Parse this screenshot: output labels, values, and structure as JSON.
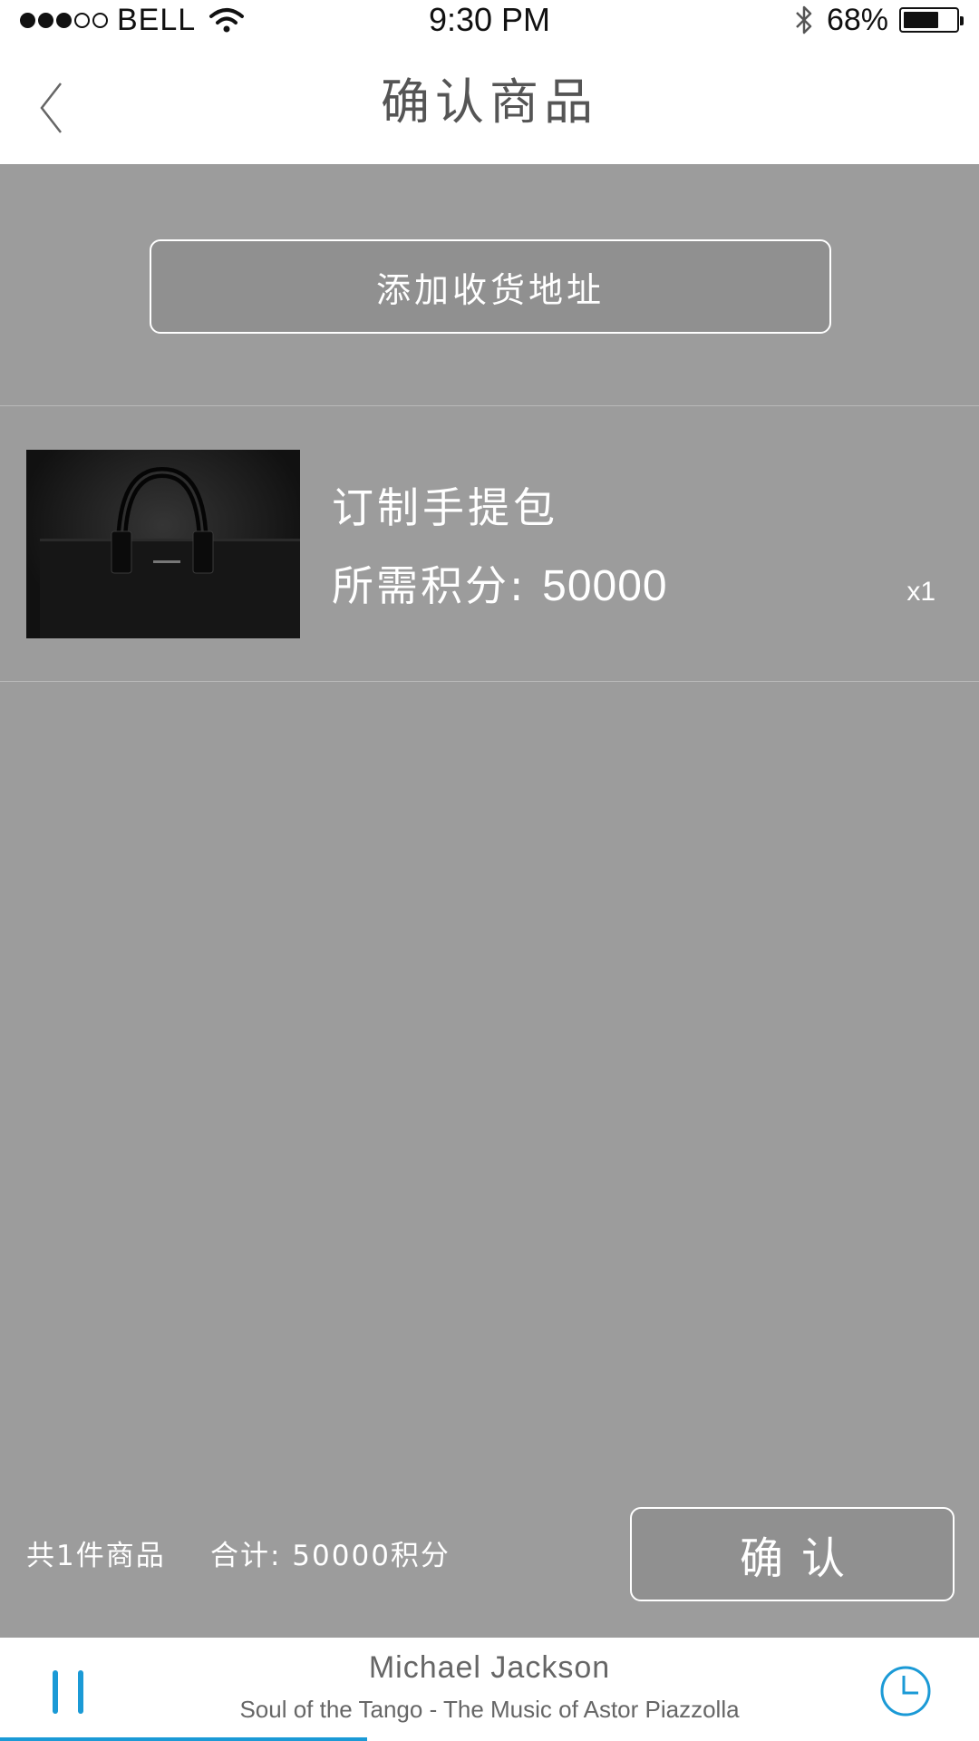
{
  "status": {
    "carrier": "BELL",
    "time": "9:30 PM",
    "battery_text": "68%",
    "battery_level": 0.68,
    "signal_bars": 3,
    "signal_total": 5
  },
  "nav": {
    "title": "确认商品",
    "back_icon": "chevron-left-icon"
  },
  "address": {
    "button_label": "添加收货地址"
  },
  "product": {
    "name": "订制手提包",
    "points_label": "所需积分:",
    "points_value": "50000",
    "quantity": "x1"
  },
  "summary": {
    "item_count": "共1件商品",
    "total": "合计: 50000积分",
    "confirm_label": "确认"
  },
  "player": {
    "artist": "Michael Jackson",
    "track": "Soul of the Tango - The Music of Astor Piazzolla",
    "progress": 0.375,
    "accent": "#1b9ad6"
  }
}
